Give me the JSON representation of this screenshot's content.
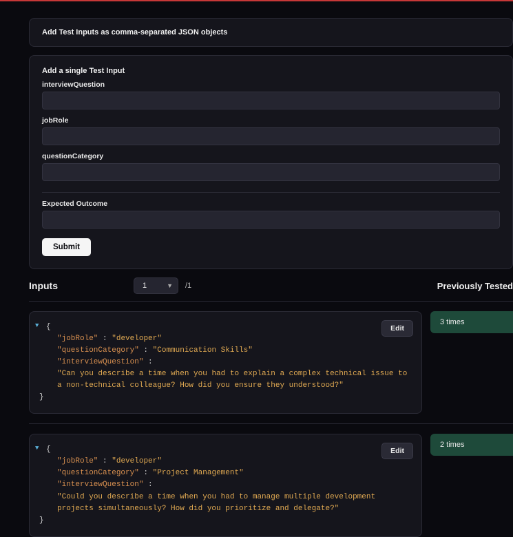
{
  "topPanel": {
    "title": "Add Test Inputs as comma-separated JSON objects"
  },
  "formPanel": {
    "title": "Add a single Test Input",
    "fields": {
      "interviewQuestion": {
        "label": "interviewQuestion",
        "value": ""
      },
      "jobRole": {
        "label": "jobRole",
        "value": ""
      },
      "questionCategory": {
        "label": "questionCategory",
        "value": ""
      },
      "expectedOutcome": {
        "label": "Expected Outcome",
        "value": ""
      }
    },
    "submitLabel": "Submit"
  },
  "inputsSection": {
    "title": "Inputs",
    "pageSelected": "1",
    "pageTotal": "/1",
    "previouslyTested": "Previously Tested"
  },
  "inputs": [
    {
      "jobRole": "developer",
      "questionCategory": "Communication Skills",
      "interviewQuestion": "Can you describe a time when you had to explain a complex technical issue to a non-technical colleague? How did you ensure they understood?",
      "editLabel": "Edit",
      "timesLabel": "3 times"
    },
    {
      "jobRole": "developer",
      "questionCategory": "Project Management",
      "interviewQuestion": "Could you describe a time when you had to manage multiple development projects simultaneously? How did you prioritize and delegate?",
      "editLabel": "Edit",
      "timesLabel": "2 times"
    }
  ],
  "jsonLabels": {
    "jobRole": "\"jobRole\"",
    "questionCategory": "\"questionCategory\"",
    "interviewQuestion": "\"interviewQuestion\"",
    "colon": " : ",
    "openBrace": "{",
    "closeBrace": "}"
  }
}
